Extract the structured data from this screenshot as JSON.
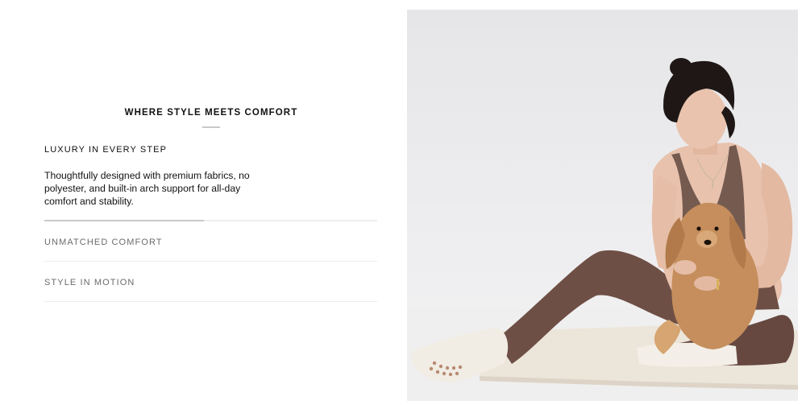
{
  "section": {
    "heading": "WHERE STYLE MEETS COMFORT"
  },
  "accordion": {
    "items": [
      {
        "title": "LUXURY IN EVERY STEP",
        "body": "Thoughtfully designed with premium fabrics, no polyester, and built-in arch support for all-day comfort and stability.",
        "expanded": true
      },
      {
        "title": "UNMATCHED COMFORT",
        "expanded": false
      },
      {
        "title": "STYLE IN MOTION",
        "expanded": false
      }
    ],
    "progress": 0.48
  },
  "image": {
    "subject": "woman-with-dog-photo",
    "colors": {
      "background": "#e9e9eb",
      "leggings": "#6e4f45",
      "dog": "#c58e5c",
      "socks": "#f1ece4",
      "mat": "#ece5da",
      "hair": "#1e1715"
    }
  }
}
